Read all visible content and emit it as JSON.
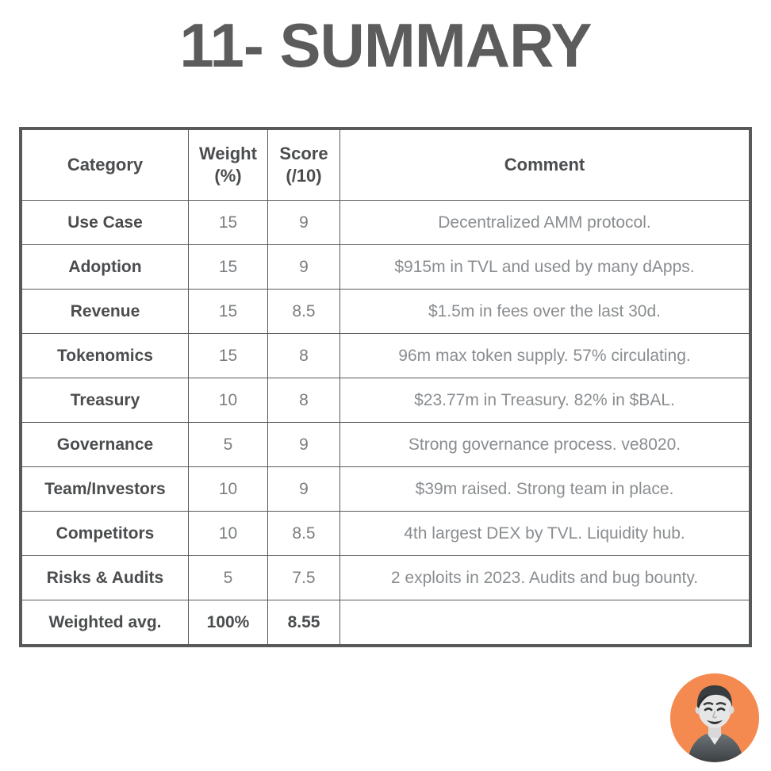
{
  "page": {
    "title": "11- SUMMARY",
    "background_color": "#ffffff",
    "accent_color": "#f58a50",
    "border_color": "#58595b",
    "title_color": "#5c5c5c"
  },
  "table": {
    "headers": {
      "category": "Category",
      "weight_line1": "Weight",
      "weight_line2": "(%)",
      "score_line1": "Score",
      "score_line2": "(/10)",
      "comment": "Comment"
    },
    "rows": [
      {
        "category": "Use Case",
        "weight": "15",
        "score": "9",
        "comment": "Decentralized AMM protocol."
      },
      {
        "category": "Adoption",
        "weight": "15",
        "score": "9",
        "comment": "$915m in TVL and used by many dApps."
      },
      {
        "category": "Revenue",
        "weight": "15",
        "score": "8.5",
        "comment": "$1.5m in fees over the last 30d."
      },
      {
        "category": "Tokenomics",
        "weight": "15",
        "score": "8",
        "comment": "96m max token supply. 57% circulating."
      },
      {
        "category": "Treasury",
        "weight": "10",
        "score": "8",
        "comment": "$23.77m in Treasury. 82% in $BAL."
      },
      {
        "category": "Governance",
        "weight": "5",
        "score": "9",
        "comment": "Strong governance process. ve8020."
      },
      {
        "category": "Team/Investors",
        "weight": "10",
        "score": "9",
        "comment": "$39m raised. Strong team in place."
      },
      {
        "category": "Competitors",
        "weight": "10",
        "score": "8.5",
        "comment": "4th largest DEX by TVL. Liquidity hub."
      },
      {
        "category": "Risks & Audits",
        "weight": "5",
        "score": "7.5",
        "comment": "2 exploits in 2023. Audits and bug bounty."
      },
      {
        "category": "Weighted avg.",
        "weight": "100%",
        "score": "8.55",
        "comment": ""
      }
    ]
  },
  "avatar": {
    "icon": "person-avatar-photo",
    "background_color": "#f58a50"
  }
}
